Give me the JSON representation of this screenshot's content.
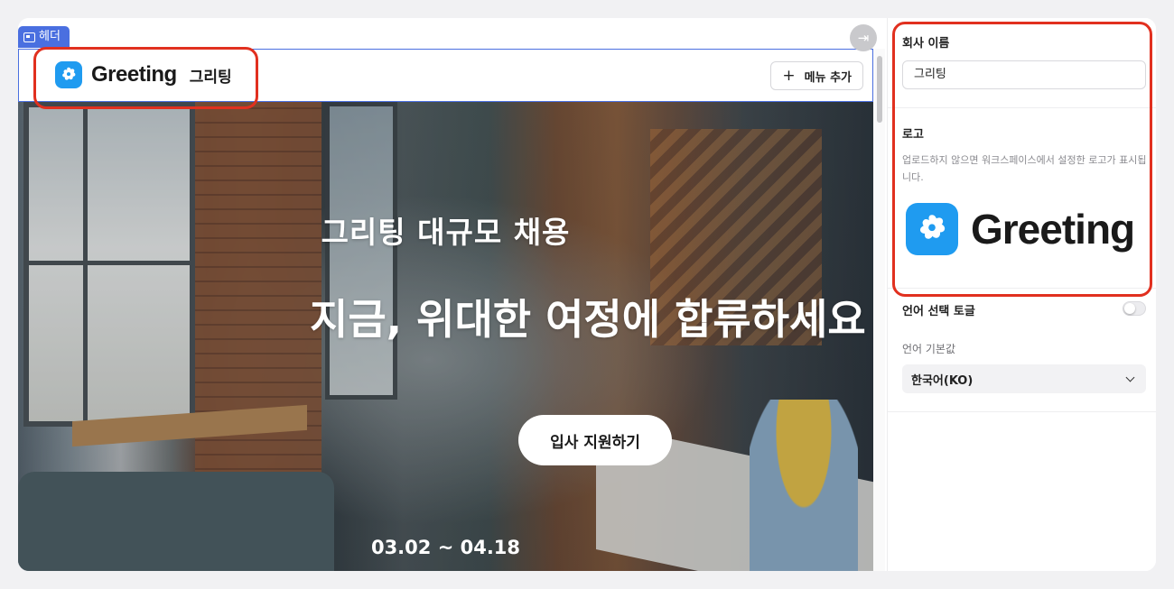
{
  "canvas": {
    "section_tag": "헤더",
    "header": {
      "brand_word": "Greeting",
      "brand_name": "그리팅",
      "add_menu_label": "메뉴 추가"
    },
    "hero": {
      "subtitle": "그리팅 대규모 채용",
      "title": "지금, 위대한 여정에 합류하세요",
      "cta_label": "입사 지원하기",
      "date_range": "03.02 ~ 04.18"
    }
  },
  "panel": {
    "company_name": {
      "label": "회사 이름",
      "value": "그리팅"
    },
    "logo": {
      "label": "로고",
      "help": "업로드하지 않으면 워크스페이스에서 설정한 로고가 표시됩니다.",
      "wordmark": "Greeting"
    },
    "language_toggle": {
      "label": "언어 선택 토글",
      "enabled": false
    },
    "default_language": {
      "label": "언어 기본값",
      "selected": "한국어(KO)"
    }
  },
  "colors": {
    "accent": "#4a6fe0",
    "highlight": "#e1301f",
    "brand_blue": "#1f9bf0"
  }
}
